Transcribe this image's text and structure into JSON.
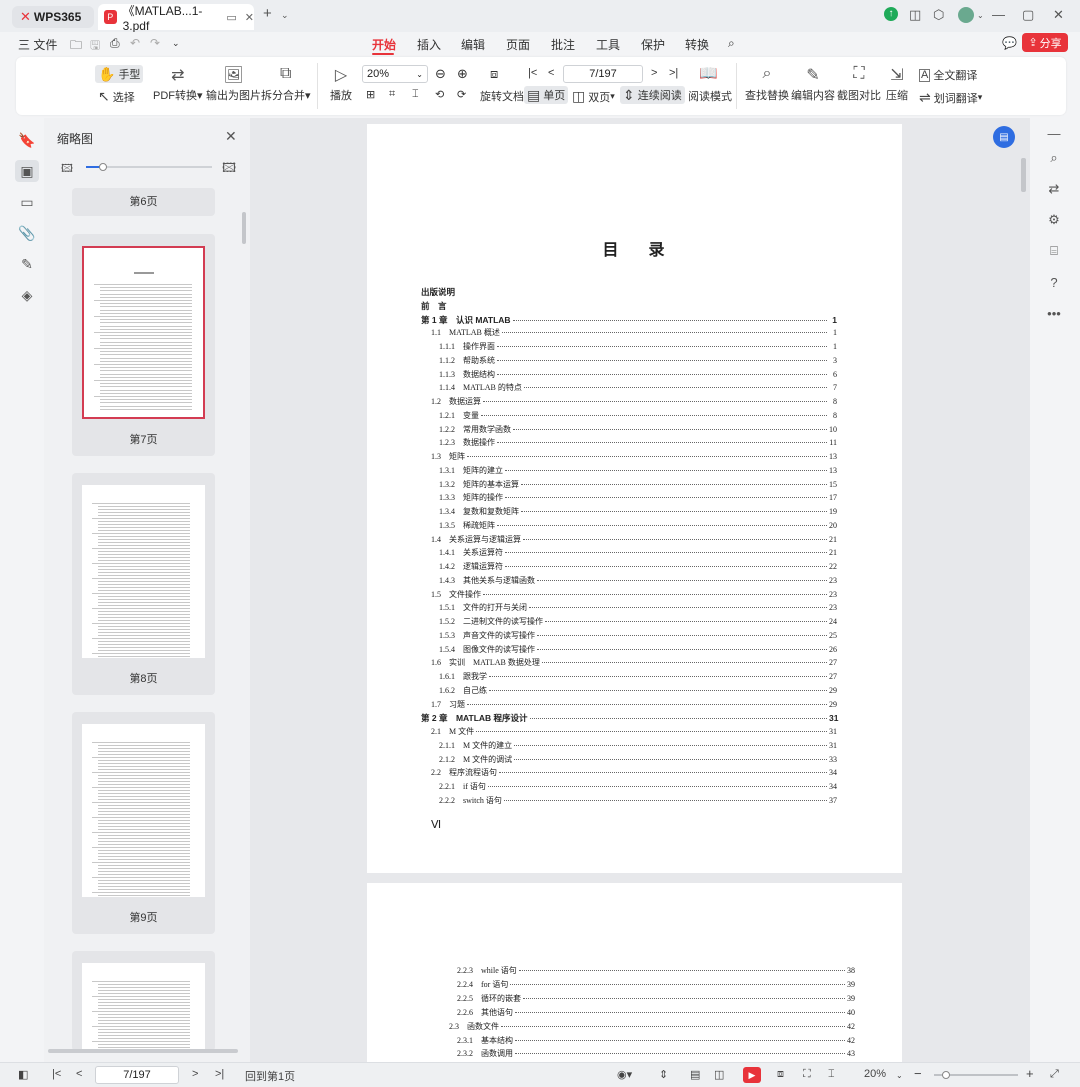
{
  "titlebar": {
    "home_tab": "WPS365",
    "doc_tab": "《MATLAB...1-3.pdf",
    "new_tab_icon": "plus-icon"
  },
  "menu": {
    "file": "三 文件",
    "tabs": [
      "开始",
      "插入",
      "编辑",
      "页面",
      "批注",
      "工具",
      "保护",
      "转换"
    ],
    "active_tab": "开始",
    "share": "分享"
  },
  "ribbon": {
    "hand": "手型",
    "select": "选择",
    "pdf_convert": "PDF转换",
    "export_image": "输出为图片",
    "split_merge": "拆分合并",
    "play": "播放",
    "zoom": "20%",
    "page_indicator": "7/197",
    "rotate": "旋转文档",
    "single": "单页",
    "double": "双页",
    "continuous": "连续阅读",
    "read_mode": "阅读模式",
    "find_replace": "查找替换",
    "edit_content": "编辑内容",
    "screenshot_compare": "截图对比",
    "compress": "压缩",
    "full_translate": "全文翻译",
    "word_translate": "划词翻译"
  },
  "thumbs": {
    "title": "缩略图",
    "labels": [
      "第6页",
      "第7页",
      "第8页",
      "第9页"
    ]
  },
  "toc": {
    "title_a": "目",
    "title_b": "录",
    "folio": "Ⅵ",
    "page7": [
      {
        "t": "出版说明",
        "p": "",
        "lvl": 0,
        "bold": true
      },
      {
        "t": "前　言",
        "p": "",
        "lvl": 0,
        "bold": true
      },
      {
        "t": "第 1 章　认识 MATLAB",
        "p": "1",
        "lvl": 0,
        "bold": true
      },
      {
        "t": "1.1　MATLAB 概述",
        "p": "1",
        "lvl": 1
      },
      {
        "t": "1.1.1　操作界面",
        "p": "1",
        "lvl": 2
      },
      {
        "t": "1.1.2　帮助系统",
        "p": "3",
        "lvl": 2
      },
      {
        "t": "1.1.3　数据结构",
        "p": "6",
        "lvl": 2
      },
      {
        "t": "1.1.4　MATLAB 的特点",
        "p": "7",
        "lvl": 2
      },
      {
        "t": "1.2　数据运算",
        "p": "8",
        "lvl": 1
      },
      {
        "t": "1.2.1　变量",
        "p": "8",
        "lvl": 2
      },
      {
        "t": "1.2.2　常用数学函数",
        "p": "10",
        "lvl": 2
      },
      {
        "t": "1.2.3　数据操作",
        "p": "11",
        "lvl": 2
      },
      {
        "t": "1.3　矩阵",
        "p": "13",
        "lvl": 1
      },
      {
        "t": "1.3.1　矩阵的建立",
        "p": "13",
        "lvl": 2
      },
      {
        "t": "1.3.2　矩阵的基本运算",
        "p": "15",
        "lvl": 2
      },
      {
        "t": "1.3.3　矩阵的操作",
        "p": "17",
        "lvl": 2
      },
      {
        "t": "1.3.4　复数和复数矩阵",
        "p": "19",
        "lvl": 2
      },
      {
        "t": "1.3.5　稀疏矩阵",
        "p": "20",
        "lvl": 2
      },
      {
        "t": "1.4　关系运算与逻辑运算",
        "p": "21",
        "lvl": 1
      },
      {
        "t": "1.4.1　关系运算符",
        "p": "21",
        "lvl": 2
      },
      {
        "t": "1.4.2　逻辑运算符",
        "p": "22",
        "lvl": 2
      },
      {
        "t": "1.4.3　其他关系与逻辑函数",
        "p": "23",
        "lvl": 2
      },
      {
        "t": "1.5　文件操作",
        "p": "23",
        "lvl": 1
      },
      {
        "t": "1.5.1　文件的打开与关闭",
        "p": "23",
        "lvl": 2
      },
      {
        "t": "1.5.2　二进制文件的读写操作",
        "p": "24",
        "lvl": 2
      },
      {
        "t": "1.5.3　声音文件的读写操作",
        "p": "25",
        "lvl": 2
      },
      {
        "t": "1.5.4　图像文件的读写操作",
        "p": "26",
        "lvl": 2
      },
      {
        "t": "1.6　实训　MATLAB 数据处理",
        "p": "27",
        "lvl": 1
      },
      {
        "t": "1.6.1　跟我学",
        "p": "27",
        "lvl": 2
      },
      {
        "t": "1.6.2　自己练",
        "p": "29",
        "lvl": 2
      },
      {
        "t": "1.7　习题",
        "p": "29",
        "lvl": 1
      },
      {
        "t": "第 2 章　MATLAB 程序设计",
        "p": "31",
        "lvl": 0,
        "bold": true
      },
      {
        "t": "2.1　M 文件",
        "p": "31",
        "lvl": 1
      },
      {
        "t": "2.1.1　M 文件的建立",
        "p": "31",
        "lvl": 2
      },
      {
        "t": "2.1.2　M 文件的调试",
        "p": "33",
        "lvl": 2
      },
      {
        "t": "2.2　程序流程语句",
        "p": "34",
        "lvl": 1
      },
      {
        "t": "2.2.1　if 语句",
        "p": "34",
        "lvl": 2
      },
      {
        "t": "2.2.2　switch 语句",
        "p": "37",
        "lvl": 2
      }
    ],
    "page8": [
      {
        "t": "2.2.3　while 语句",
        "p": "38",
        "lvl": 2
      },
      {
        "t": "2.2.4　for 语句",
        "p": "39",
        "lvl": 2
      },
      {
        "t": "2.2.5　循环的嵌套",
        "p": "39",
        "lvl": 2
      },
      {
        "t": "2.2.6　其他语句",
        "p": "40",
        "lvl": 2
      },
      {
        "t": "2.3　函数文件",
        "p": "42",
        "lvl": 1
      },
      {
        "t": "2.3.1　基本结构",
        "p": "42",
        "lvl": 2
      },
      {
        "t": "2.3.2　函数调用",
        "p": "43",
        "lvl": 2
      }
    ]
  },
  "status": {
    "page": "7/197",
    "back_to_page": "回到第1页",
    "zoom": "20%"
  },
  "colors": {
    "accent": "#e8333a",
    "blue": "#2f6de1"
  }
}
